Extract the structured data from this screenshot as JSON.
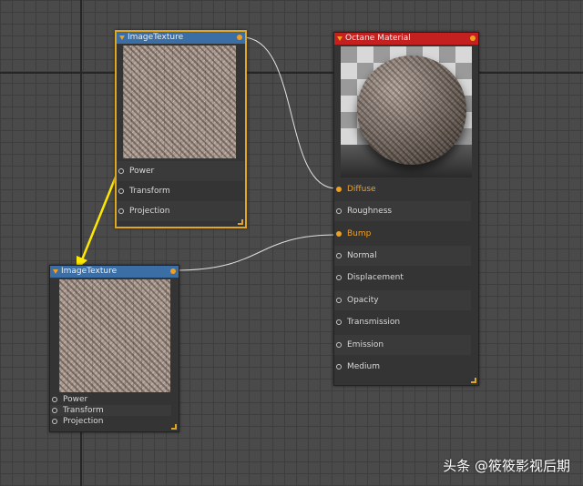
{
  "nodes": {
    "image_texture_1": {
      "title": "ImageTexture",
      "pins": [
        "Power",
        "Transform",
        "Projection"
      ]
    },
    "image_texture_2": {
      "title": "ImageTexture",
      "pins": [
        "Power",
        "Transform",
        "Projection"
      ]
    },
    "octane_material": {
      "title": "Octane Material",
      "pins": [
        "Diffuse",
        "Roughness",
        "Bump",
        "Normal",
        "Displacement",
        "Opacity",
        "Transmission",
        "Emission",
        "Medium"
      ],
      "connected_pins": [
        "Diffuse",
        "Bump"
      ]
    }
  },
  "colors": {
    "texture_header": "#3a6ea5",
    "material_header": "#c42020",
    "selection_border": "#e0a820",
    "connected_pin": "#f0a020",
    "wire": "#e0e0e0",
    "annotation_arrow": "#ffe800"
  },
  "watermark": "头条 @筱筱影视后期"
}
